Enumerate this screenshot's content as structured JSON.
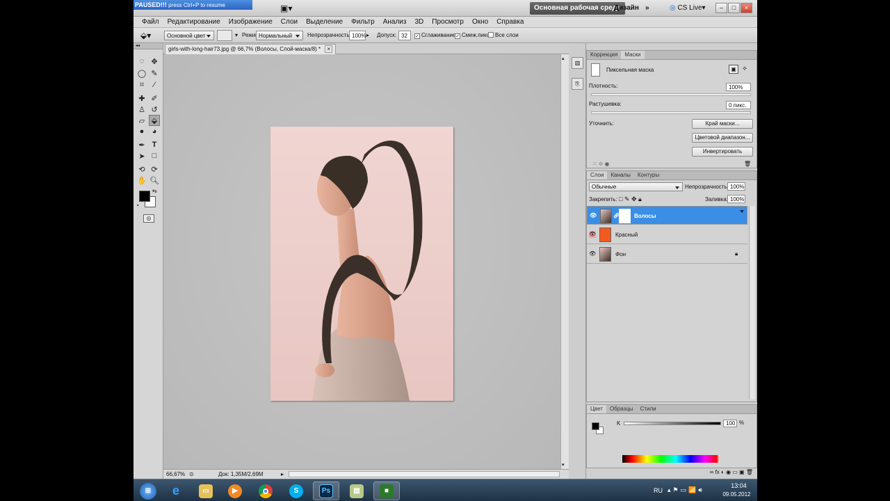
{
  "app": {
    "paused_text": "PAUSED!!!",
    "paused_hint": "press Ctrl+P to resume",
    "workspace_main": "Основная рабочая среда",
    "workspace_design": "Дизайн",
    "workspace_more": "»",
    "cs_live": "CS Live",
    "win_min": "–",
    "win_max": "□",
    "win_close": "×"
  },
  "menu": [
    "Файл",
    "Редактирование",
    "Изображение",
    "Слои",
    "Выделение",
    "Фильтр",
    "Анализ",
    "3D",
    "Просмотр",
    "Окно",
    "Справка"
  ],
  "options": {
    "source": "Основной цвет",
    "mode_label": "Режим:",
    "mode_value": "Нормальный",
    "opacity_label": "Непрозрачность:",
    "opacity_value": "100%",
    "tolerance_label": "Допуск:",
    "tolerance_value": "32",
    "antialias": "Сглаживание",
    "contiguous": "Смеж.пикс",
    "all_layers": "Все слои"
  },
  "document": {
    "tab_title": "girls-with-long-hair73.jpg @ 66,7% (Волосы, Слой-маска/8) *",
    "tab_close": "×",
    "zoom": "66,67%",
    "doc_info": "Док: 1,35M/2,69M"
  },
  "masks_panel": {
    "tab_correction": "Коррекция",
    "tab_masks": "Маски",
    "pixel_mask": "Пиксельная маска",
    "density_label": "Плотность:",
    "density_value": "100%",
    "feather_label": "Растушевка:",
    "feather_value": "0 пикс.",
    "refine_label": "Уточнить:",
    "btn_edge": "Край маски...",
    "btn_color_range": "Цветовой диапазон...",
    "btn_invert": "Инвертировать"
  },
  "layers_panel": {
    "tab_layers": "Слои",
    "tab_channels": "Каналы",
    "tab_paths": "Контуры",
    "blend_mode": "Обычные",
    "opacity_label": "Непрозрачность:",
    "opacity_value": "100%",
    "lock_label": "Закрепить:",
    "fill_label": "Заливка:",
    "fill_value": "100%",
    "layers": [
      {
        "name": "Волосы",
        "selected": true
      },
      {
        "name": "Красный",
        "selected": false
      },
      {
        "name": "Фон",
        "selected": false
      }
    ],
    "layer_color_red": "#f25a1e"
  },
  "color_panel": {
    "tab_color": "Цвет",
    "tab_swatches": "Образцы",
    "tab_styles": "Стили",
    "k_label": "K",
    "k_value": "100",
    "percent": "%"
  },
  "taskbar": {
    "lang": "RU",
    "time": "13:04",
    "date": "09.05.2012",
    "ps_label": "Ps"
  }
}
